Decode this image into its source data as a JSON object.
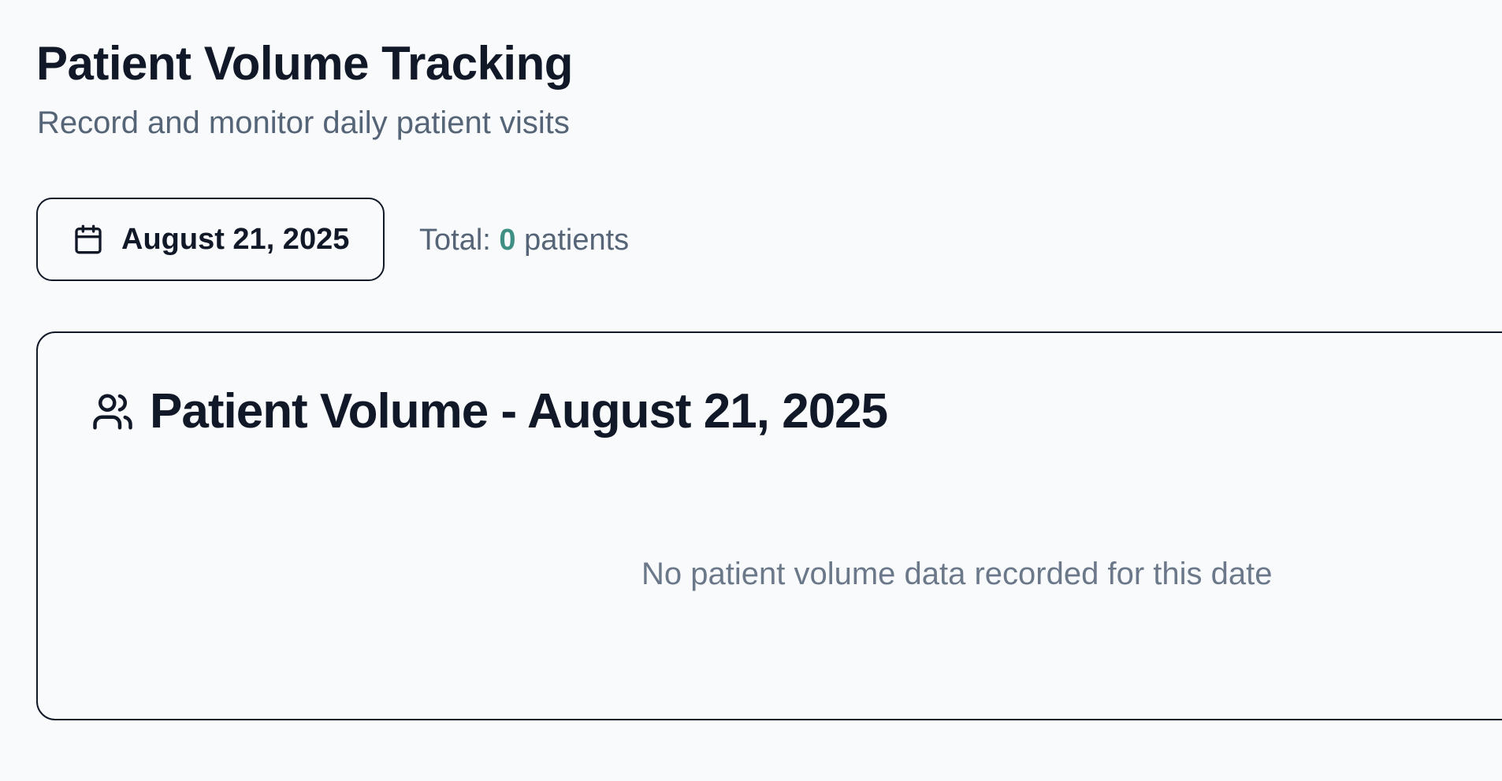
{
  "header": {
    "title": "Patient Volume Tracking",
    "subtitle": "Record and monitor daily patient visits"
  },
  "date_picker": {
    "icon": "calendar-icon",
    "label": "August 21, 2025"
  },
  "total": {
    "prefix": "Total: ",
    "count": "0",
    "suffix": " patients",
    "count_color": "#3f8f84"
  },
  "card": {
    "icon": "users-icon",
    "title": "Patient Volume - August 21, 2025",
    "empty_message": "No patient volume data recorded for this date"
  }
}
